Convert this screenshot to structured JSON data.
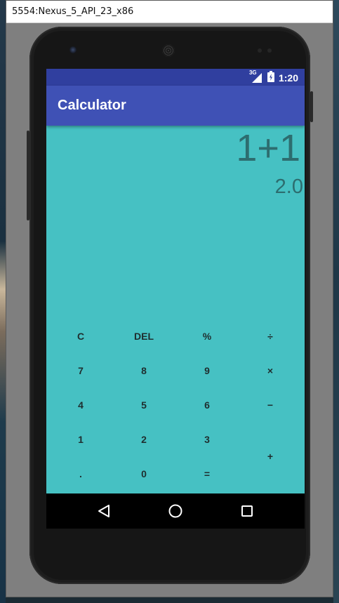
{
  "window": {
    "title": "5554:Nexus_5_API_23_x86"
  },
  "statusbar": {
    "network": "3G",
    "time": "1:20"
  },
  "app": {
    "title": "Calculator"
  },
  "display": {
    "expression": "1+1",
    "result": "2.0"
  },
  "keys": {
    "clear": "C",
    "delete": "DEL",
    "percent": "%",
    "divide": "÷",
    "seven": "7",
    "eight": "8",
    "nine": "9",
    "multiply": "×",
    "four": "4",
    "five": "5",
    "six": "6",
    "minus": "−",
    "one": "1",
    "two": "2",
    "three": "3",
    "plus": "+",
    "dot": ".",
    "zero": "0",
    "equals": "="
  },
  "navbar": {
    "icons": [
      "back-icon",
      "home-icon",
      "recents-icon"
    ]
  },
  "colors": {
    "screen_bg": "#46c1c3",
    "appbar": "#3f51b5",
    "statusbar": "#303f9f",
    "display_text": "#2d6d6f"
  }
}
